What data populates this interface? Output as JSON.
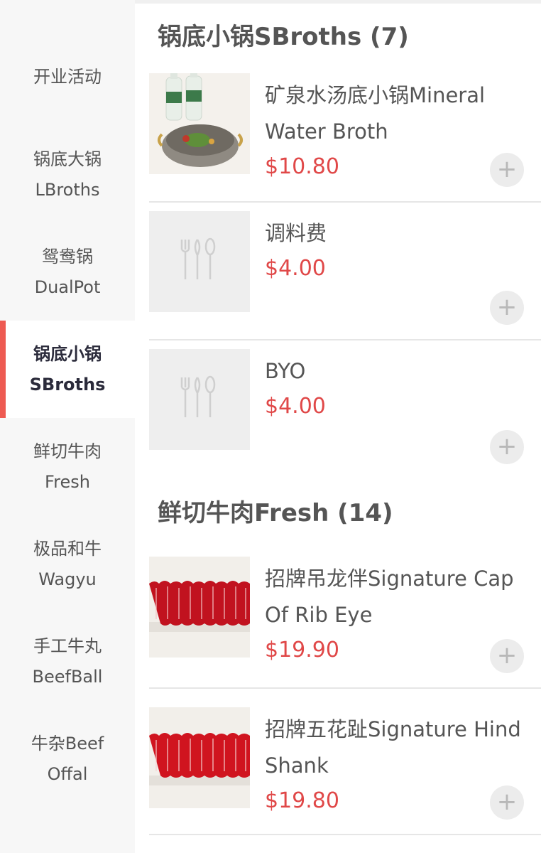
{
  "sidebar": {
    "items": [
      {
        "label_lines": [
          "开业活动"
        ],
        "active": false
      },
      {
        "label_lines": [
          "锅底大锅",
          "LBroths"
        ],
        "active": false
      },
      {
        "label_lines": [
          "鸳鸯锅",
          "DualPot"
        ],
        "active": false
      },
      {
        "label_lines": [
          "锅底小锅",
          "SBroths"
        ],
        "active": true
      },
      {
        "label_lines": [
          "鲜切牛肉",
          "Fresh"
        ],
        "active": false
      },
      {
        "label_lines": [
          "极品和牛",
          "Wagyu"
        ],
        "active": false
      },
      {
        "label_lines": [
          "手工牛丸",
          "BeefBall"
        ],
        "active": false
      },
      {
        "label_lines": [
          "牛杂Beef",
          "Offal"
        ],
        "active": false
      }
    ],
    "accent_color": "#ee5a52"
  },
  "sections": [
    {
      "title": "锅底小锅SBroths (7)",
      "items": [
        {
          "name": "矿泉水汤底小锅Mineral Water Broth",
          "price": "$10.80",
          "image": "mineral-water-broth-photo"
        },
        {
          "name": "调料费",
          "price": "$4.00",
          "image": "cutlery-placeholder-icon"
        },
        {
          "name": "BYO",
          "price": "$4.00",
          "image": "cutlery-placeholder-icon"
        }
      ]
    },
    {
      "title": "鲜切牛肉Fresh (14)",
      "items": [
        {
          "name": "招牌吊龙伴Signature Cap Of Rib Eye",
          "price": "$19.90",
          "image": "sliced-beef-photo"
        },
        {
          "name": "招牌五花趾Signature Hind Shank",
          "price": "$19.80",
          "image": "sliced-beef-photo"
        }
      ]
    }
  ],
  "add_button_symbol": "+",
  "price_color": "#e04848"
}
